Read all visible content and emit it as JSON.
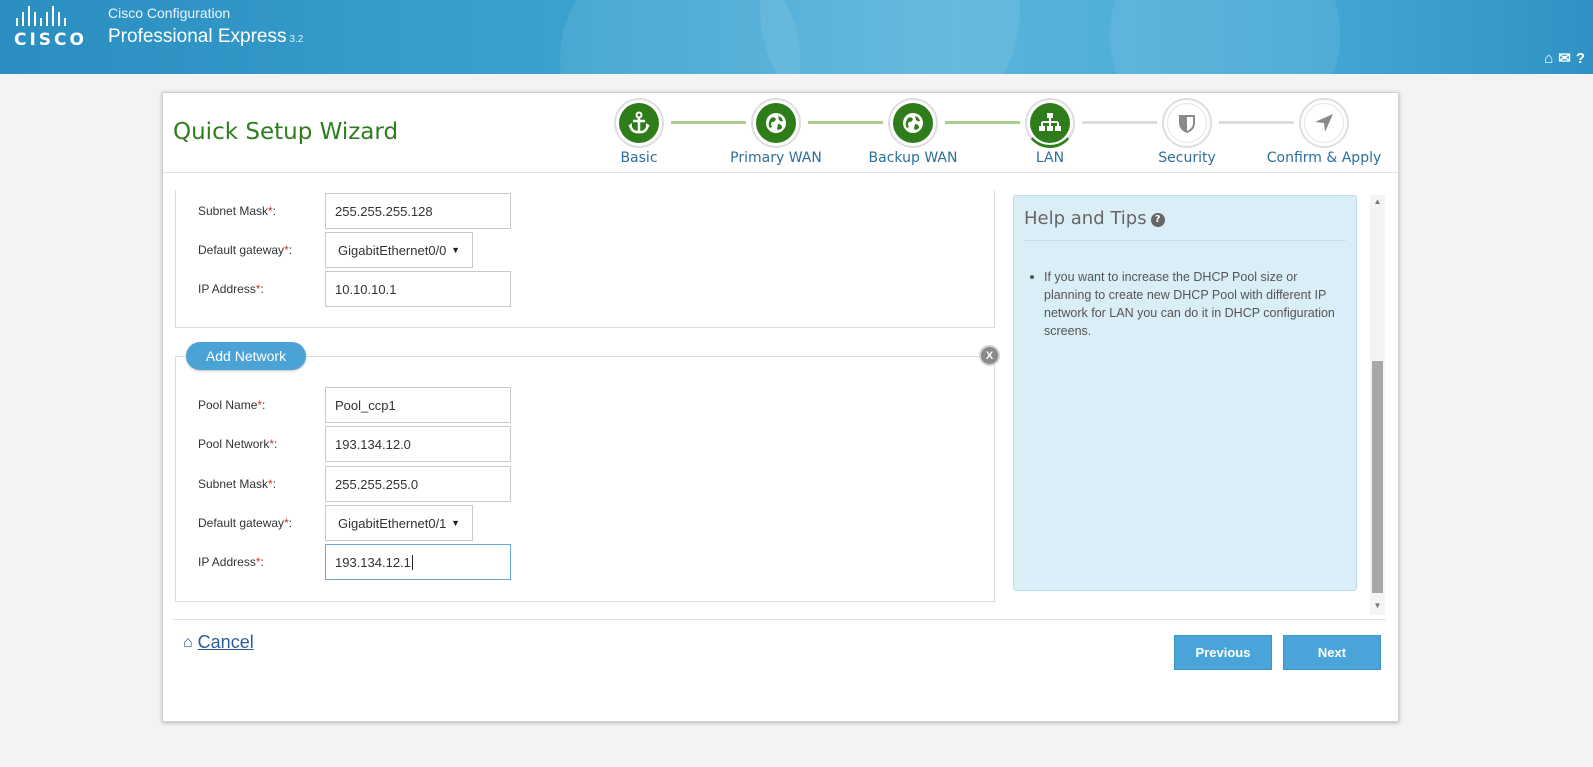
{
  "header": {
    "brand": "cisco",
    "app_small": "Cisco Configuration",
    "app_big": "Professional Express",
    "version": "3.2",
    "icons": [
      "home-icon",
      "mail-icon",
      "help-icon"
    ],
    "home_glyph": "⌂",
    "mail_glyph": "✉",
    "help_glyph": "?"
  },
  "wizard": {
    "title": "Quick Setup Wizard",
    "steps": [
      {
        "label": "Basic",
        "icon": "anchor-icon",
        "state": "done"
      },
      {
        "label": "Primary WAN",
        "icon": "globe-icon",
        "state": "done"
      },
      {
        "label": "Backup WAN",
        "icon": "globe-icon",
        "state": "done"
      },
      {
        "label": "LAN",
        "icon": "network-tree-icon",
        "state": "current"
      },
      {
        "label": "Security",
        "icon": "shield-icon",
        "state": "todo"
      },
      {
        "label": "Confirm & Apply",
        "icon": "navigation-arrow-icon",
        "state": "todo"
      }
    ]
  },
  "network1": {
    "subnet_label": "Subnet Mask",
    "subnet": "255.255.255.128",
    "gateway_label": "Default gateway",
    "gateway": "GigabitEthernet0/0",
    "ip_label": "IP Address",
    "ip": "10.10.10.1"
  },
  "network2": {
    "add_label": "Add Network",
    "close": "X",
    "pool_name_label": "Pool Name",
    "pool_name": "Pool_ccp1",
    "pool_network_label": "Pool Network",
    "pool_network": "193.134.12.0",
    "subnet_label": "Subnet Mask",
    "subnet": "255.255.255.0",
    "gateway_label": "Default gateway",
    "gateway": "GigabitEthernet0/1",
    "ip_label": "IP Address",
    "ip": "193.134.12.1"
  },
  "required_marker": "*",
  "label_suffix": ":",
  "help": {
    "title": "Help and Tips",
    "q": "?",
    "text": "If you want to increase the DHCP Pool size or planning to create new DHCP Pool with different IP network for LAN you can do it in DHCP configuration screens."
  },
  "footer": {
    "cancel": "Cancel",
    "previous": "Previous",
    "next": "Next"
  },
  "colors": {
    "accent_green": "#2e7d1a",
    "accent_blue": "#4aa3d9",
    "connector_done": "#a9cd8a",
    "connector_todo": "#dcdcdc"
  }
}
